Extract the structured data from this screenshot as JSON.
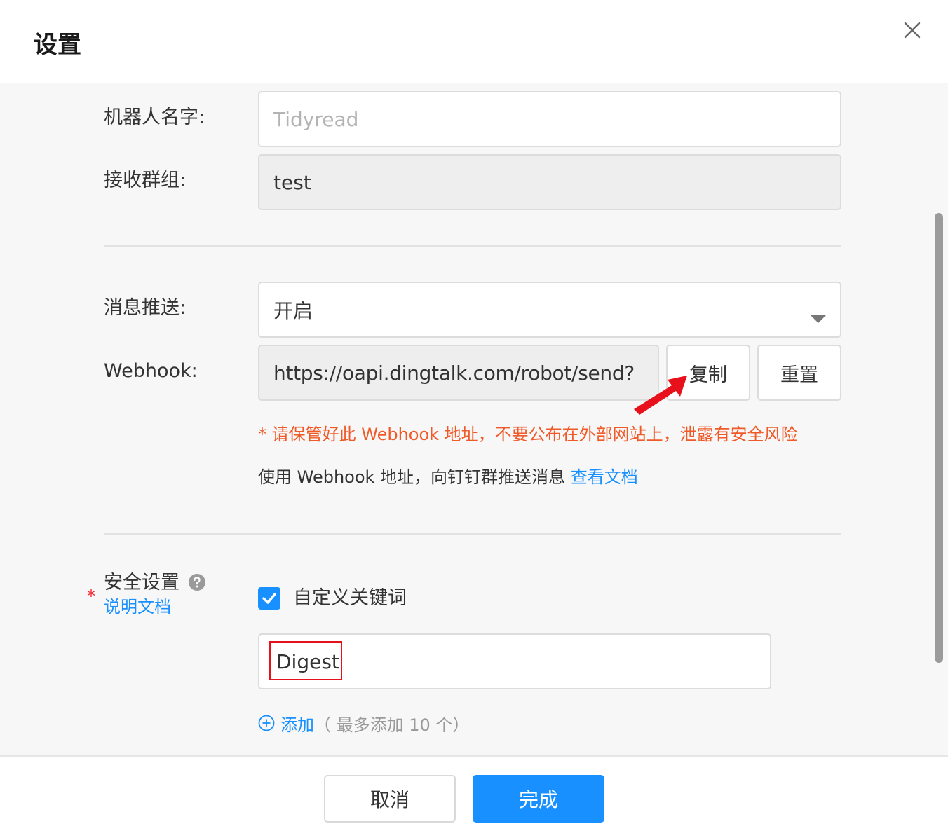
{
  "dialog": {
    "title": "设置",
    "close_icon": "close-icon"
  },
  "form": {
    "robot_name": {
      "label": "机器人名字:",
      "placeholder": "Tidyread"
    },
    "group": {
      "label": "接收群组:",
      "value": "test"
    },
    "push": {
      "label": "消息推送:",
      "value": "开启",
      "icon": "caret-down-icon"
    },
    "webhook": {
      "label": "Webhook:",
      "value": "https://oapi.dingtalk.com/robot/send?",
      "copy_label": "复制",
      "reset_label": "重置",
      "warning": "* 请保管好此 Webhook 地址，不要公布在外部网站上，泄露有安全风险",
      "hint": "使用 Webhook 地址，向钉钉群推送消息",
      "doc_link": "查看文档"
    },
    "security": {
      "required_mark": "*",
      "label": "安全设置",
      "help_icon": "question-circle-icon",
      "doc_link": "说明文档",
      "custom_keyword_label": "自定义关键词",
      "custom_keyword_checked": true,
      "keyword_value": "Digest",
      "add_icon": "plus-circle-icon",
      "add_label": "添加",
      "add_limit": "（ 最多添加 10 个）"
    }
  },
  "footer": {
    "cancel_label": "取消",
    "confirm_label": "完成"
  },
  "colors": {
    "primary": "#1890ff",
    "warning": "#f05a28",
    "required": "#f5222d",
    "annotation_red": "#e8101a"
  }
}
